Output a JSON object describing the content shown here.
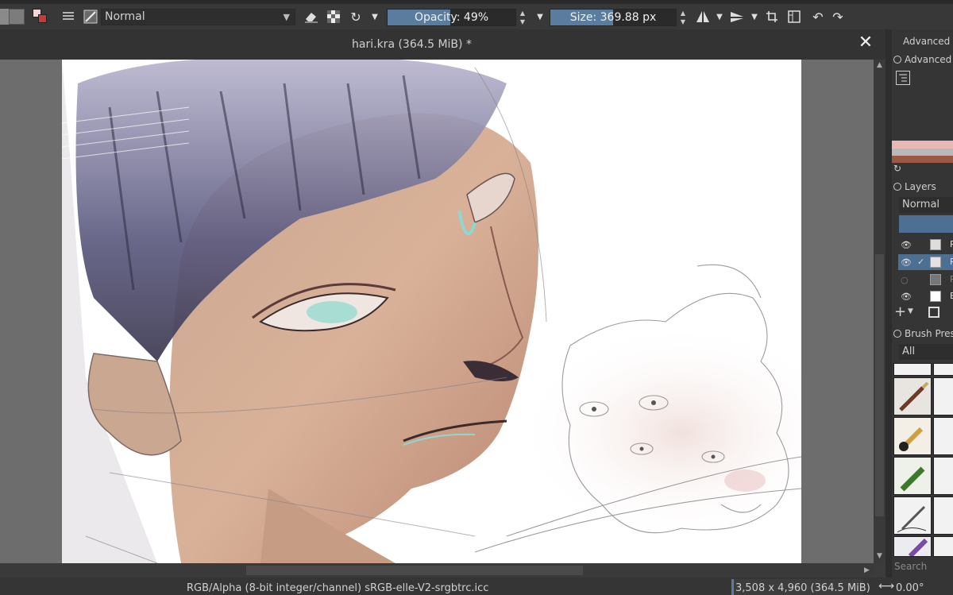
{
  "toolbar": {
    "blend_mode": "Normal",
    "opacity_label": "Opacity: 49%",
    "opacity_value": 0.49,
    "size_label": "Size: 369.88 px",
    "size_fill": 0.5
  },
  "document": {
    "tab_title": "hari.kra (364.5 MiB) *",
    "close": "✕"
  },
  "status": {
    "color_info": "RGB/Alpha (8-bit integer/channel)  sRGB-elle-V2-srgbtrc.icc",
    "image_size": "3,508 x 4,960 (364.5 MiB)",
    "rotation": "0.00°"
  },
  "docker": {
    "advanced_header": "Advanced C",
    "advanced_label": "Advanced",
    "layers_title": "Layers",
    "layers_blend": "Normal",
    "layers": [
      {
        "name": "P",
        "visible": true,
        "selected": false
      },
      {
        "name": "P",
        "visible": true,
        "selected": true
      },
      {
        "name": "P",
        "visible": false,
        "selected": false
      },
      {
        "name": "B",
        "visible": true,
        "selected": false
      }
    ],
    "brush_title": "Brush Pres",
    "brush_filter": "All",
    "search_placeholder": "Search"
  },
  "colors": {
    "accent": "#5a7d9f",
    "canvas_bg": "#6d6d6d",
    "panel": "#353535"
  }
}
